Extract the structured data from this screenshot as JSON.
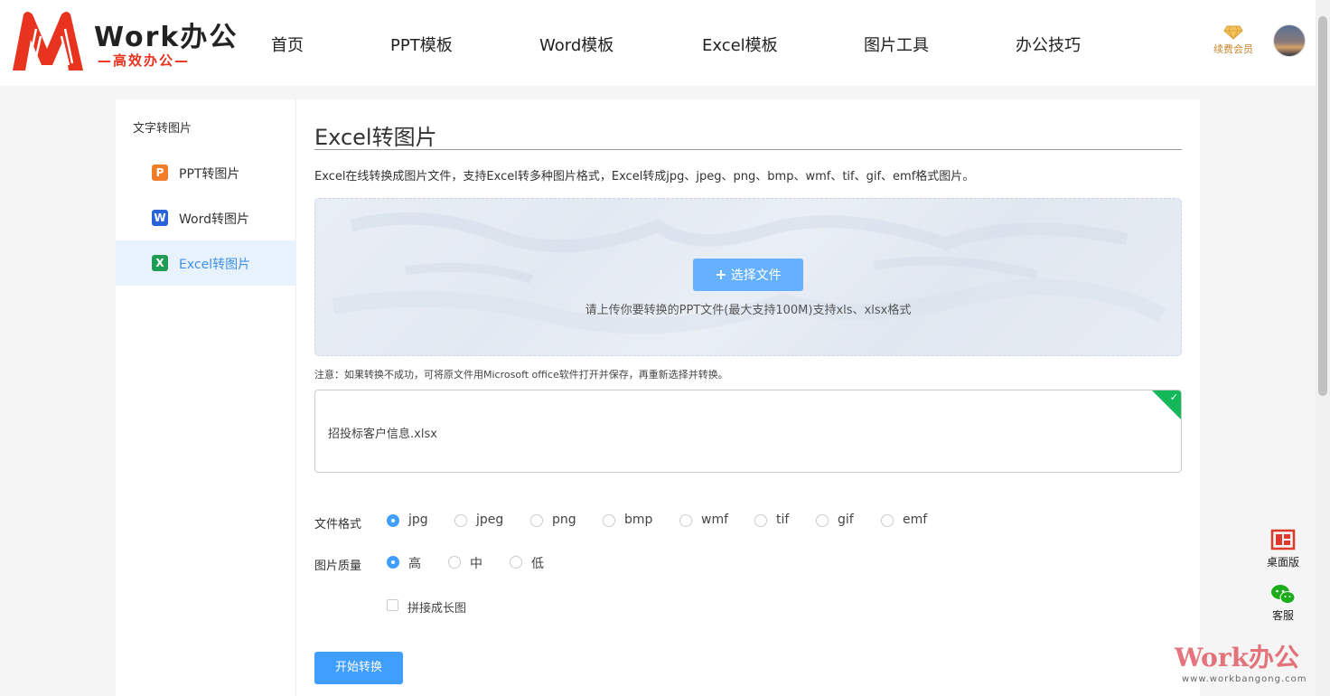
{
  "brand": {
    "name": "Work办公",
    "tagline": "—高效办公—"
  },
  "nav": {
    "items": [
      "首页",
      "PPT模板",
      "Word模板",
      "Excel模板",
      "图片工具",
      "办公技巧"
    ]
  },
  "header": {
    "vip_label": "续费会员"
  },
  "sidebar": {
    "title": "文字转图片",
    "items": [
      {
        "label": "PPT转图片",
        "icon": "P",
        "color": "#f07d2a"
      },
      {
        "label": "Word转图片",
        "icon": "W",
        "color": "#2a62d9"
      },
      {
        "label": "Excel转图片",
        "icon": "X",
        "color": "#1f9d55"
      }
    ]
  },
  "main": {
    "title": "Excel转图片",
    "description": "Excel在线转换成图片文件，支持Excel转多种图片格式，Excel转成jpg、jpeg、png、bmp、wmf、tif、gif、emf格式图片。",
    "upload": {
      "button": "选择文件",
      "hint": "请上传你要转换的PPT文件(最大支持100M)支持xls、xlsx格式"
    },
    "note": "注意：如果转换不成功，可将原文件用Microsoft office软件打开并保存，再重新选择并转换。",
    "file": {
      "name": "招投标客户信息.xlsx"
    },
    "format": {
      "label": "文件格式",
      "options": [
        "jpg",
        "jpeg",
        "png",
        "bmp",
        "wmf",
        "tif",
        "gif",
        "emf"
      ],
      "selected": "jpg"
    },
    "quality": {
      "label": "图片质量",
      "options": [
        "高",
        "中",
        "低"
      ],
      "selected": "高"
    },
    "merge": {
      "label": "拼接成长图",
      "checked": false
    },
    "start_button": "开始转换"
  },
  "float": {
    "desktop": "桌面版",
    "service": "客服"
  },
  "watermark": {
    "title": "Work办公",
    "url": "www.workbangong.com"
  },
  "colors": {
    "primary": "#409eff",
    "accent": "#e8341f",
    "success": "#13b85a"
  }
}
